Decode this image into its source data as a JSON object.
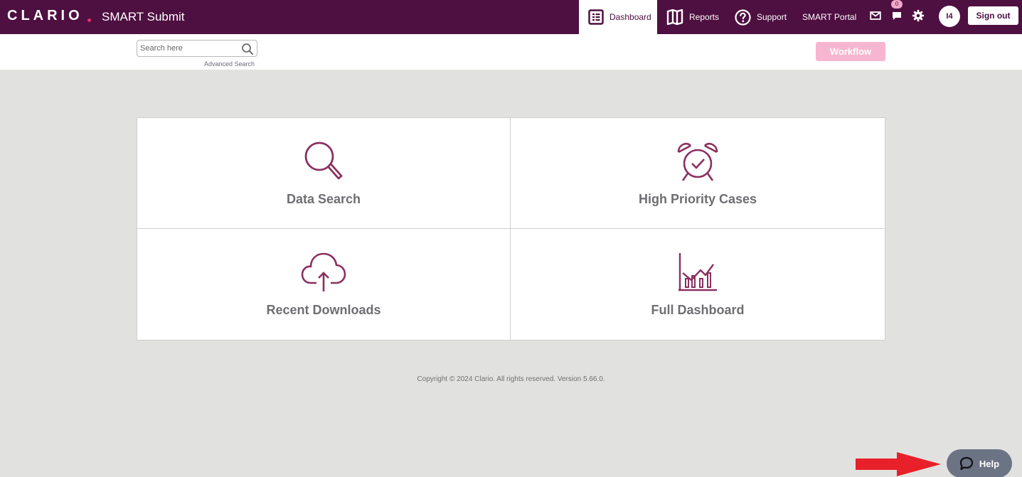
{
  "header": {
    "logo": "CLARIO",
    "app_title": "SMART Submit",
    "nav": {
      "dashboard": "Dashboard",
      "reports": "Reports",
      "support": "Support",
      "portal": "SMART Portal"
    },
    "notification_count": "0",
    "avatar_initials": "I4",
    "sign_out": "Sign out"
  },
  "toolbar": {
    "search_placeholder": "Search here",
    "advanced_search": "Advanced Search",
    "workflow": "Workflow"
  },
  "tiles": [
    {
      "label": "Data Search",
      "icon": "magnifier-icon"
    },
    {
      "label": "High Priority Cases",
      "icon": "alarm-clock-icon"
    },
    {
      "label": "Recent Downloads",
      "icon": "cloud-upload-icon"
    },
    {
      "label": "Full Dashboard",
      "icon": "bar-chart-icon"
    }
  ],
  "footer": {
    "copyright": "Copyright © 2024 Clario. All rights reserved. Version 5.66.0."
  },
  "help": {
    "label": "Help"
  },
  "colors": {
    "brand": "#4e0f41",
    "accent": "#e8296b",
    "icon": "#8a3060",
    "workflow": "#f7b6cf",
    "help": "#6b7384",
    "annotation_arrow": "#e8202a"
  }
}
